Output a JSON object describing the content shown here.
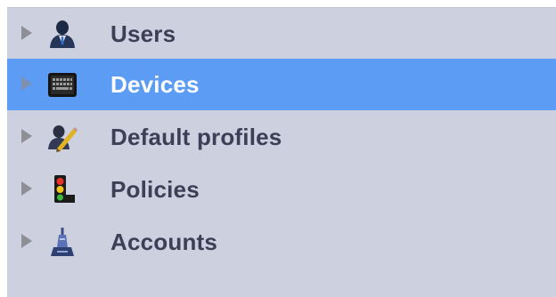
{
  "tree": {
    "items": [
      {
        "label": "Users",
        "icon": "user-icon",
        "selected": false
      },
      {
        "label": "Devices",
        "icon": "keyboard-device-icon",
        "selected": true
      },
      {
        "label": "Default profiles",
        "icon": "profile-edit-icon",
        "selected": false
      },
      {
        "label": "Policies",
        "icon": "traffic-light-icon",
        "selected": false
      },
      {
        "label": "Accounts",
        "icon": "account-tower-icon",
        "selected": false
      }
    ],
    "selected_color": "#5d9cf5",
    "background_color": "#cdd0df"
  }
}
